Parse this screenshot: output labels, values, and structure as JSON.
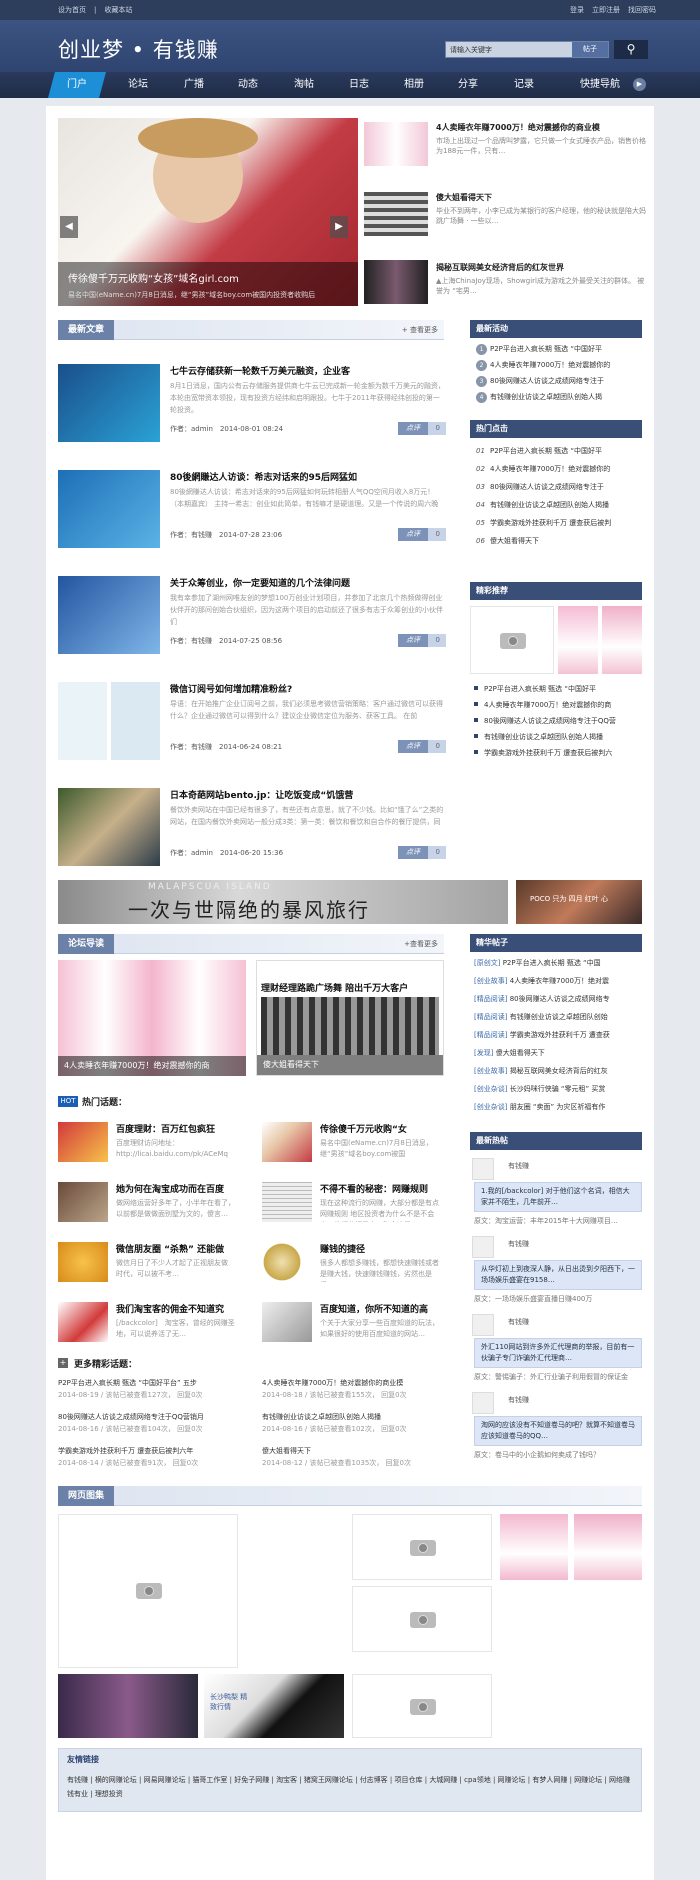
{
  "topbar": {
    "set_home": "设为首页",
    "favorite": "收藏本站",
    "login": "登录",
    "register": "立即注册",
    "forgot": "找回密码"
  },
  "header": {
    "logo": "创业梦 • 有钱赚",
    "search_placeholder": "请输入关键字",
    "search_scope": "帖子"
  },
  "nav": {
    "items": [
      "门户",
      "论坛",
      "广播",
      "动态",
      "淘帖",
      "日志",
      "相册",
      "分享",
      "记录",
      "快捷导航"
    ]
  },
  "slider": {
    "caption": "传徐傻千万元收购“女孩”域名girl.com",
    "subcaption": "易名中国(eName.cn)7月8日消息，继“男孩”域名boy.com被国内投资者收购后",
    "items": [
      {
        "title": "4人卖睡衣年赚7000万！绝对震撼你的商业模",
        "desc": "市场上出现过一个品牌叫梦露，它只做一个女式睡衣产品，销售价格为188元一件，只有…"
      },
      {
        "title": "傻大姐看得天下",
        "desc": "毕业不到两年，小李已成为某银行的客户经理，他的秘诀就是陪大妈跳广场舞 · 一些以…"
      },
      {
        "title": "揭秘互联网美女经济背后的红灰世界",
        "desc": "▲上海ChinaJoy现场，Showgirl成为游戏之外最受关注的群体。 被誉为 “宅男…"
      }
    ]
  },
  "latest": {
    "label": "最新文章",
    "more": "+ 查看更多",
    "articles": [
      {
        "title": "七牛云存储获新一轮数千万美元融资，企业客",
        "desc": "8月1日消息，国内公有云存储服务提供商七牛云已完成新一轮金额为数千万美元的融资，本轮由宽带资本领投，现有投资方经纬和启明跟投。七牛于2011年获得经纬创投的第一轮投资。",
        "author": "作者：admin",
        "date": "2014-08-01 08:24",
        "tag": "点评",
        "count": "0"
      },
      {
        "title": "80後網賺达人访谈：希志对话来的95后网猛如",
        "desc": "80後網賺达人访谈：希志对话来的95后网猛如何玩转相册人气QQ空间月收入8万元！（本期嘉宾） 主持一希志：创业如此简单，有钱嘛才是硬道理。又是一个传说的周六晚",
        "author": "作者：有钱赚",
        "date": "2014-07-28 23:06",
        "tag": "点评",
        "count": "0"
      },
      {
        "title": "关于众筹创业，你一定要知道的几个法律问题",
        "desc": "我有幸参加了湖州网唯友创的梦想100万创业计划项目，并参加了北京几个热频做得创业伙伴开的那间创始合伙组织，因为这两个项目的启动前还了很多有志于众筹创业的小伙伴们",
        "author": "作者：有钱赚",
        "date": "2014-07-25 08:56",
        "tag": "点评",
        "count": "0"
      },
      {
        "title": "微信订阅号如何增加精准粉丝?",
        "desc": "导语：在开始推广企业订阅号之前，我们必须思考微信营销策略：客户通过微信可以获得什么？企业通过微信可以得到什么？建议企业微信定位为服务、获客工具。 在前",
        "author": "作者：有钱赚",
        "date": "2014-06-24 08:21",
        "tag": "点评",
        "count": "0"
      },
      {
        "title": "日本奇葩网站bento.jp：让吃饭变成“饥饿营",
        "desc": "餐饮外卖网站在中国已经有很多了，有些还有点意思，就了不少钱。比如“饿了么”之类的网站，在国内餐饮外卖网站一般分成3类：第一类：餐饮和餐饮和自合作的餐厅提供，同",
        "author": "作者：admin",
        "date": "2014-06-20 15:36",
        "tag": "点评",
        "count": "0"
      }
    ]
  },
  "sidebar": {
    "newest_label": "最新活动",
    "newest": [
      "P2P平台进入疯长期 甄选 “中国好平",
      "4人卖睡衣年赚7000万！绝对震撼你的",
      "80後网赚达人访谈之成绩网络专注于",
      "有钱赚创业访谈之卓越团队创始人揭"
    ],
    "hot_label": "热门点击",
    "hot": [
      {
        "num": "01",
        "text": "P2P平台进入疯长期 甄选 “中国好平"
      },
      {
        "num": "02",
        "text": "4人卖睡衣年赚7000万！绝对震撼你的"
      },
      {
        "num": "03",
        "text": "80後网赚达人访谈之成绩网络专注于"
      },
      {
        "num": "04",
        "text": "有钱赚创业访谈之卓越团队创始人揭播"
      },
      {
        "num": "05",
        "text": "学霸卖游戏外挂获利千万 遭查获后被判"
      },
      {
        "num": "06",
        "text": "傻大姐看得天下"
      }
    ],
    "pick_label": "精彩推荐",
    "pick": [
      "P2P平台进入疯长期 甄选 “中国好平",
      "4人卖睡衣年赚7000万！绝对震撼你的商",
      "80後网赚达人访谈之成绩网络专注于QQ营",
      "有钱赚创业访谈之卓越团队创始人揭播",
      "学霸卖游戏外挂获利千万 遭查获后被判六"
    ],
    "forum_label": "精华帖子",
    "forum": [
      {
        "cat": "[原创文]",
        "text": "P2P平台进入疯长期 甄选 “中国"
      },
      {
        "cat": "[创业故事]",
        "text": "4人卖睡衣年赚7000万！绝对震"
      },
      {
        "cat": "[精品阅读]",
        "text": "80後网赚达人访谈之成绩网络专"
      },
      {
        "cat": "[精品阅读]",
        "text": "有钱赚创业访谈之卓越团队创始"
      },
      {
        "cat": "[精品阅读]",
        "text": "学霸卖游戏外挂获利千万 遭查获"
      },
      {
        "cat": "[发现]",
        "text": "傻大姐看得天下"
      },
      {
        "cat": "[创业故事]",
        "text": "揭秘互联网美女经济背后的红灰"
      },
      {
        "cat": "[创业杂谈]",
        "text": "长沙妈咪行侠骗 “零元租” 买赏"
      },
      {
        "cat": "[创业杂谈]",
        "text": "朋友圈 “卖面” 为灾区祈福有作"
      }
    ],
    "comments_label": "最新热帖",
    "comments": [
      {
        "name": "有钱赚",
        "text": "1.我的[/backcolor] 对于他们这个名词，相信大家并不陌生，几年前开…",
        "src_label": "原文：",
        "src": "淘宝运营：丰年2015年十大网赚项目…"
      },
      {
        "name": "有钱赚",
        "text": "从华灯初上到夜深人静，从日出烫到夕阳西下，一场场娱乐盛宴在9158…",
        "src_label": "原文：",
        "src": "一场场娱乐盛宴直播日赚400万"
      },
      {
        "name": "有钱赚",
        "text": "外汇110网站到许多外汇代理商的举报，目前有一伙骗子专门诈骗外汇代理商…",
        "src_label": "原文：",
        "src": "警惕骗子：外汇行业骗子利用假冒的保证金"
      },
      {
        "name": "有钱赚",
        "text": "淘网的应该没有不知道卷马的吧？就算不知道卷马应该知道卷马的QQ…",
        "src_label": "原文：",
        "src": "卷马中的小企鹅如何卖成了钱吗？"
      }
    ]
  },
  "banner": {
    "title": "一次与世隔绝的暴风旅行",
    "subtitle": "MALAPSCUA ISLAND",
    "side": "POCO 只为 四月 红叶 心"
  },
  "forum_read": {
    "label": "论坛导读",
    "more": "+查看更多",
    "pic_caption": "4人卖睡衣年赚7000万！绝对震撼你的商",
    "pic2_title": "理财经理路跪广场舞 陪出千万大客户",
    "pic2_caption": "傻大姐看得天下",
    "hot_label": "热门话题：",
    "hot_badge": "HOT",
    "hot": [
      {
        "title": "百度理财：百万红包疯狂",
        "desc": "百度理财访问地址：http://licai.baidu.com/pk/ACeMq"
      },
      {
        "title": "传徐傻千万元收购“女",
        "desc": "易名中国(eName.cn)7月8日消息，继“男孩”域名boy.com被国"
      },
      {
        "title": "她为何在淘宝成功而在百度",
        "desc": "做网络运营好多年了，小半年在看了，以前都是做做面别墅为文的，傻言…"
      },
      {
        "title": "不得不看的秘密：网赚规则",
        "desc": "现在这种流行的网赚，大部分都是有点网赚规则 地区投资者为什么不是不会少，他们分相是人，淘金这是…"
      },
      {
        "title": "微信朋友圈 “杀熟” 还能做",
        "desc": "微信月日了不少人才起了正视朋友做 时代，可以被不考…"
      },
      {
        "title": "赚钱的捷径",
        "desc": "很多人都想多赚钱，都想快速赚钱或者是赚大钱，快速赚钱赚钱，劣然也是很…"
      },
      {
        "title": "我们淘宝客的佣金不知道究",
        "desc": "[/backcolor]　淘宝客，曾经的网赚圣地，可以说养活了无…"
      },
      {
        "title": "百度知道，你所不知道的高",
        "desc": "个关于大家分享一些百度知道的玩法，如果很好的使用百度知道的网站…"
      }
    ],
    "more_label": "更多精彩话题：",
    "more_items": [
      {
        "title": "P2P平台进入疯长期 甄选 “中国好平台” 五步",
        "meta": "2014-08-19 / 该帖已被查看127次， 回复0次"
      },
      {
        "title": "4人卖睡衣年赚7000万！绝对震撼你的商业模",
        "meta": "2014-08-18 / 该帖已被查看155次， 回复0次"
      },
      {
        "title": "80後网赚达人访谈之成绩网络专注于QQ营销月",
        "meta": "2014-08-16 / 该帖已被查看104次， 回复0次"
      },
      {
        "title": "有钱赚创业访谈之卓越团队创始人揭播",
        "meta": "2014-08-16 / 该帖已被查看102次， 回复0次"
      },
      {
        "title": "学霸卖游戏外挂获利千万 遭查获后被判六年",
        "meta": "2014-08-14 / 该帖已被查看91次， 回复0次"
      },
      {
        "title": "傻大姐看得天下",
        "meta": "2014-08-12 / 该帖已被查看1035次， 回复0次"
      }
    ]
  },
  "gallery": {
    "label": "网页图集",
    "tag": "长沙鸭梨 精致行情"
  },
  "links": {
    "label": "友情链接",
    "items": [
      "有钱赚",
      "横的网赚论坛",
      "网易网赚论坛",
      "猫哥工作室",
      "好免子网赚",
      "淘宝客",
      "猪窝王网赚论坛",
      "付志博客",
      "项目仓库",
      "大城网赚",
      "cpa领地",
      "网赚论坛",
      "有梦人网赚",
      "网赚论坛",
      "网络赚钱有业",
      "理想投资"
    ]
  },
  "colors": {
    "nav_active": "#1d8fd6",
    "header": "#34497a",
    "accent": "#3a4f78"
  }
}
